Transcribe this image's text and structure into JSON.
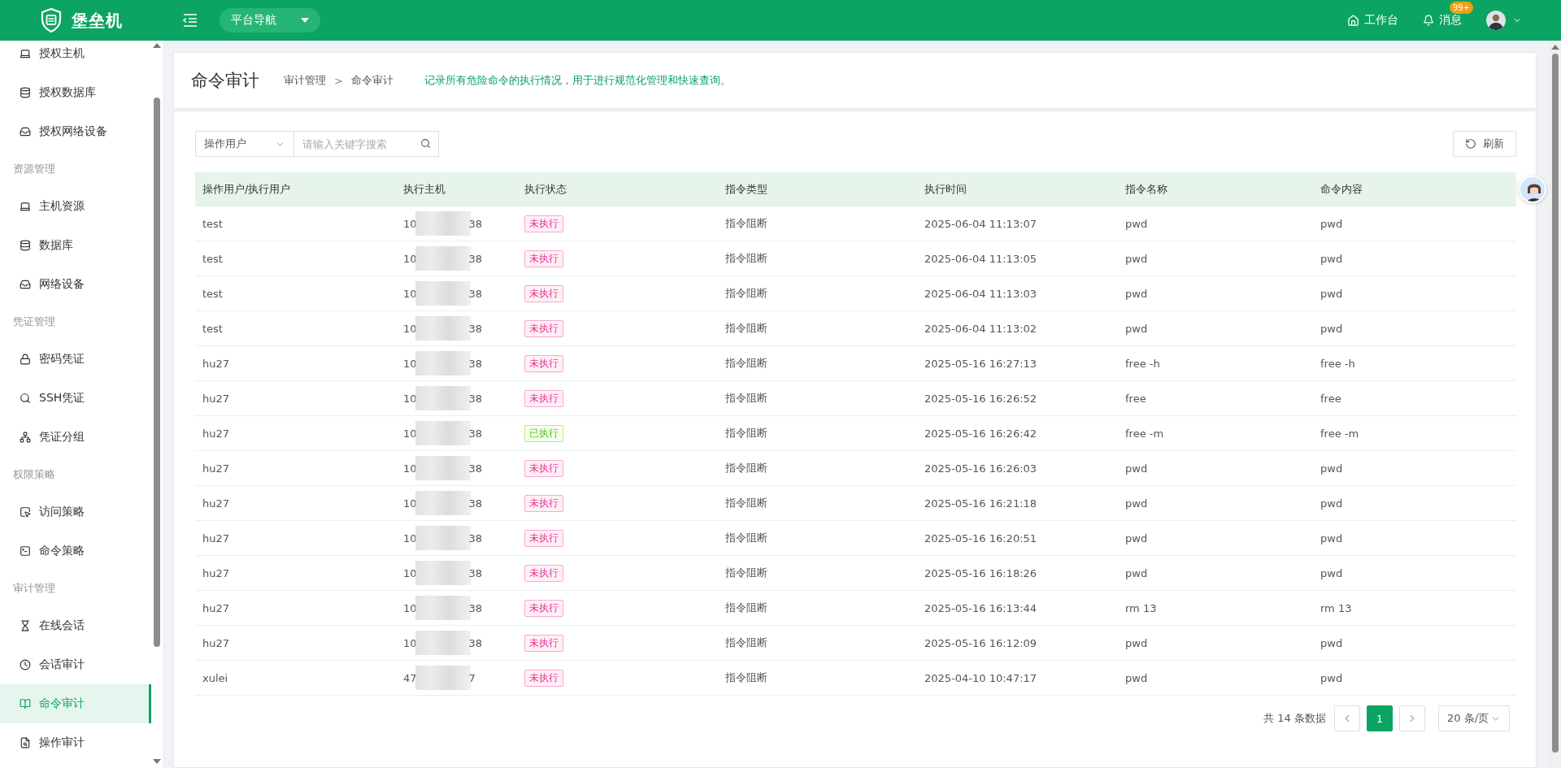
{
  "header": {
    "app_name": "堡垒机",
    "nav_button": "平台导航",
    "workbench": "工作台",
    "messages": "消息",
    "message_badge": "99+"
  },
  "sidebar": [
    {
      "items": [
        {
          "label": "授权主机",
          "selected": false
        },
        {
          "label": "授权数据库",
          "selected": false
        },
        {
          "label": "授权网络设备",
          "selected": false
        }
      ]
    },
    {
      "label": "资源管理",
      "items": [
        {
          "label": "主机资源",
          "selected": false
        },
        {
          "label": "数据库",
          "selected": false
        },
        {
          "label": "网络设备",
          "selected": false
        }
      ]
    },
    {
      "label": "凭证管理",
      "items": [
        {
          "label": "密码凭证",
          "selected": false
        },
        {
          "label": "SSH凭证",
          "selected": false
        },
        {
          "label": "凭证分组",
          "selected": false
        }
      ]
    },
    {
      "label": "权限策略",
      "items": [
        {
          "label": "访问策略",
          "selected": false
        },
        {
          "label": "命令策略",
          "selected": false
        }
      ]
    },
    {
      "label": "审计管理",
      "items": [
        {
          "label": "在线会话",
          "selected": false
        },
        {
          "label": "会话审计",
          "selected": false
        },
        {
          "label": "命令审计",
          "selected": true
        },
        {
          "label": "操作审计",
          "selected": false
        }
      ]
    }
  ],
  "page": {
    "title": "命令审计",
    "breadcrumb": [
      "审计管理",
      "命令审计"
    ],
    "breadcrumb_separator": ">",
    "description": "记录所有危险命令的执行情况，用于进行规范化管理和快速查询。"
  },
  "toolbar": {
    "filter_select": "操作用户",
    "search_placeholder": "请输入关键字搜索",
    "refresh_button": "刷新"
  },
  "table": {
    "columns": [
      "操作用户/执行用户",
      "执行主机",
      "执行状态",
      "指令类型",
      "执行时间",
      "指令名称",
      "命令内容"
    ],
    "rows": [
      {
        "user": "test",
        "host_start": "10",
        "host_end": "38",
        "status": "未执行",
        "executed": false,
        "type": "指令阻断",
        "time": "2025-06-04 11:13:07",
        "name": "pwd",
        "content": "pwd"
      },
      {
        "user": "test",
        "host_start": "10",
        "host_end": "38",
        "status": "未执行",
        "executed": false,
        "type": "指令阻断",
        "time": "2025-06-04 11:13:05",
        "name": "pwd",
        "content": "pwd"
      },
      {
        "user": "test",
        "host_start": "10",
        "host_end": "38",
        "status": "未执行",
        "executed": false,
        "type": "指令阻断",
        "time": "2025-06-04 11:13:03",
        "name": "pwd",
        "content": "pwd"
      },
      {
        "user": "test",
        "host_start": "10",
        "host_end": "38",
        "status": "未执行",
        "executed": false,
        "type": "指令阻断",
        "time": "2025-06-04 11:13:02",
        "name": "pwd",
        "content": "pwd"
      },
      {
        "user": "hu27",
        "host_start": "10",
        "host_end": "38",
        "status": "未执行",
        "executed": false,
        "type": "指令阻断",
        "time": "2025-05-16 16:27:13",
        "name": "free -h",
        "content": "free -h"
      },
      {
        "user": "hu27",
        "host_start": "10",
        "host_end": "38",
        "status": "未执行",
        "executed": false,
        "type": "指令阻断",
        "time": "2025-05-16 16:26:52",
        "name": "free",
        "content": "free"
      },
      {
        "user": "hu27",
        "host_start": "10",
        "host_end": "38",
        "status": "已执行",
        "executed": true,
        "type": "指令阻断",
        "time": "2025-05-16 16:26:42",
        "name": "free -m",
        "content": "free -m"
      },
      {
        "user": "hu27",
        "host_start": "10",
        "host_end": "38",
        "status": "未执行",
        "executed": false,
        "type": "指令阻断",
        "time": "2025-05-16 16:26:03",
        "name": "pwd",
        "content": "pwd"
      },
      {
        "user": "hu27",
        "host_start": "10",
        "host_end": "38",
        "status": "未执行",
        "executed": false,
        "type": "指令阻断",
        "time": "2025-05-16 16:21:18",
        "name": "pwd",
        "content": "pwd"
      },
      {
        "user": "hu27",
        "host_start": "10",
        "host_end": "38",
        "status": "未执行",
        "executed": false,
        "type": "指令阻断",
        "time": "2025-05-16 16:20:51",
        "name": "pwd",
        "content": "pwd"
      },
      {
        "user": "hu27",
        "host_start": "10",
        "host_end": "38",
        "status": "未执行",
        "executed": false,
        "type": "指令阻断",
        "time": "2025-05-16 16:18:26",
        "name": "pwd",
        "content": "pwd"
      },
      {
        "user": "hu27",
        "host_start": "10",
        "host_end": "38",
        "status": "未执行",
        "executed": false,
        "type": "指令阻断",
        "time": "2025-05-16 16:13:44",
        "name": "rm 13",
        "content": "rm 13"
      },
      {
        "user": "hu27",
        "host_start": "10",
        "host_end": "38",
        "status": "未执行",
        "executed": false,
        "type": "指令阻断",
        "time": "2025-05-16 16:12:09",
        "name": "pwd",
        "content": "pwd"
      },
      {
        "user": "xulei",
        "host_start": "47",
        "host_end": "7",
        "status": "未执行",
        "executed": false,
        "type": "指令阻断",
        "time": "2025-04-10 10:47:17",
        "name": "pwd",
        "content": "pwd"
      }
    ]
  },
  "pagination": {
    "total": "共 14 条数据",
    "pages": [
      {
        "label": "1",
        "selected": true
      }
    ],
    "page_size": "20 条/页"
  }
}
